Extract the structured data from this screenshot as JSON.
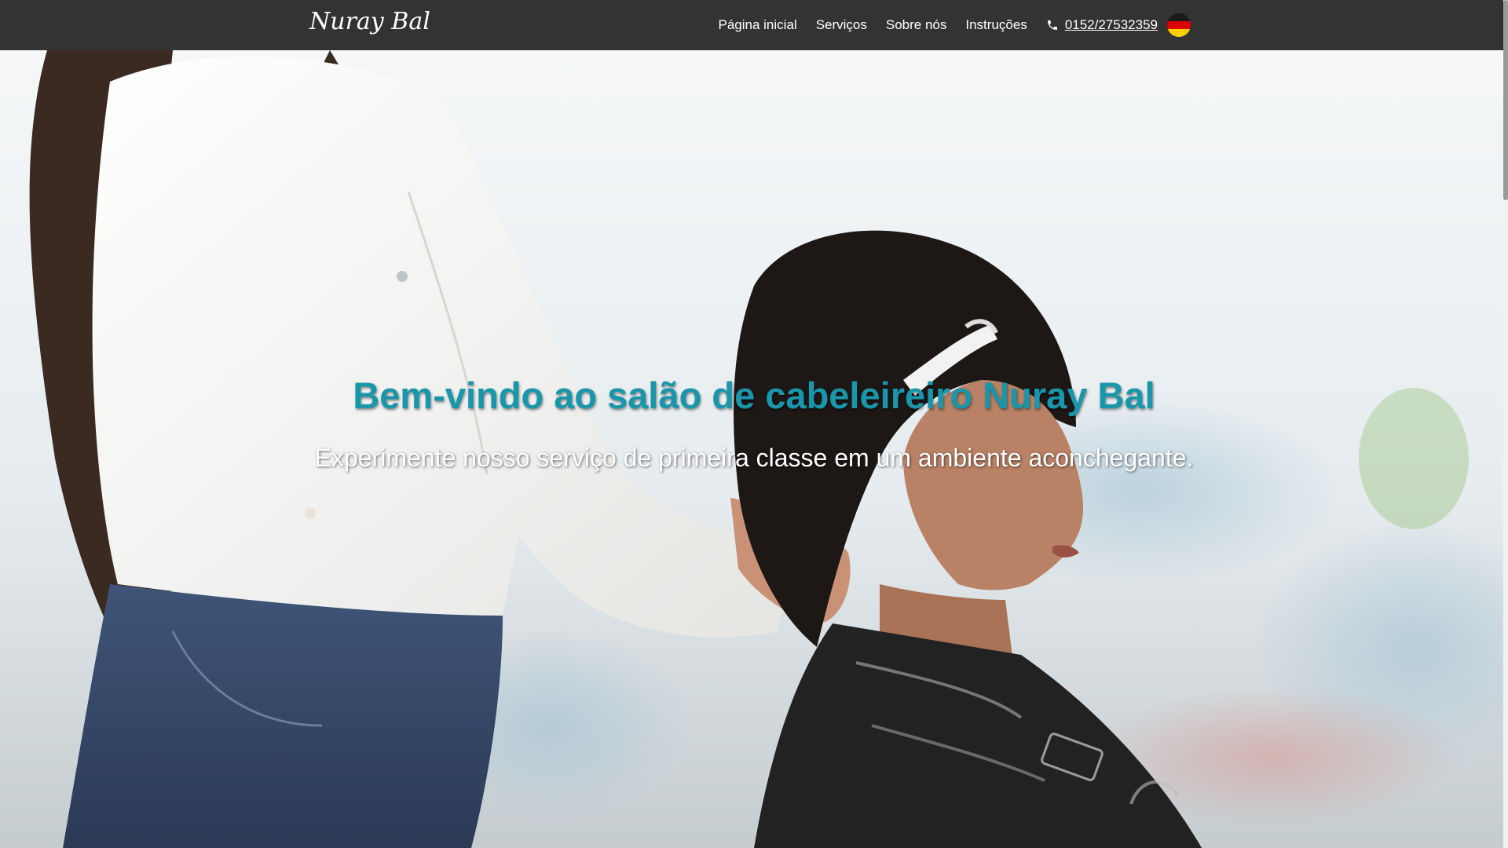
{
  "header": {
    "logo_text": "Nuray Bal",
    "nav": [
      {
        "label": "Página inicial"
      },
      {
        "label": "Serviços"
      },
      {
        "label": "Sobre nós"
      },
      {
        "label": "Instruções"
      }
    ],
    "phone": {
      "icon": "phone-icon",
      "number": "0152/27532359"
    },
    "language": {
      "icon": "german-flag-icon"
    }
  },
  "hero": {
    "title": "Bem-vindo ao salão de cabeleireiro Nuray Bal",
    "subtitle": "Experimente nosso serviço de primeira classe em um ambiente aconchegante.",
    "background_photo": "hairdresser-styling-client-photo"
  },
  "colors": {
    "navbar": "#333333",
    "accent": "#1a96aa",
    "text_light": "#ffffff"
  },
  "scroll": {
    "position": 0.0
  }
}
